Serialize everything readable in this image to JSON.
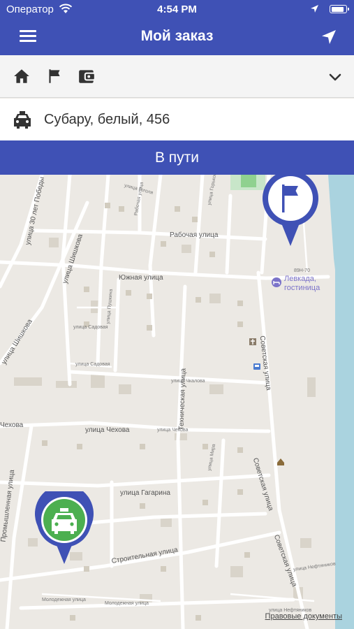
{
  "status_bar": {
    "carrier": "Оператор",
    "time": "4:54 PM",
    "battery_percent": 86
  },
  "header": {
    "title": "Мой заказ",
    "menu_icon": "hamburger-menu-icon",
    "action_icon": "navigation-arrow-icon"
  },
  "toolbar": {
    "icons": [
      "home-icon",
      "flag-icon",
      "wallet-icon"
    ],
    "expand_icon": "chevron-down-icon"
  },
  "car": {
    "icon": "taxi-car-icon",
    "description": "Субару, белый, 456"
  },
  "order_status": "В пути",
  "map": {
    "streets": {
      "s1": "улица 30 лет Победы",
      "s2": "улица Шишкова",
      "s3": "улица Шишкова",
      "s4": "Рабочая улица",
      "s5": "Южная улица",
      "s6": "Советская улица",
      "s7": "Техническая улица",
      "s8": "Чехова",
      "s9": "улица Чехова",
      "s10": "Советская улица",
      "s11": "улица Гагарина",
      "s12": "Промышленная улица",
      "s13": "Строительная улица",
      "s14": "Советская улица",
      "s15": "Молодежная улица"
    },
    "small_labels": {
      "a": "улица Гоголя",
      "b": "улица Горького",
      "c": "улица Пушкина",
      "d": "Рабочая улица",
      "e": "улица Садовая",
      "f": "улица Садовая",
      "g": "улица Чкалова",
      "h": "улица Чехова",
      "i": "улица Мира",
      "j": "улица Нефтяников",
      "k": "улица Нефтяников",
      "l": "Молодежная улица",
      "m": "89Н-70"
    },
    "poi_hotel": {
      "line1": "Левкада,",
      "line2": "гостиница"
    },
    "destination_marker_icon": "flag-icon",
    "taxi_marker_icon": "taxi-car-icon",
    "destination_color": "#3f51b5",
    "taxi_color": "#4caf50"
  },
  "legal_link": "Правовые документы",
  "colors": {
    "primary": "#3f51b5",
    "map_bg": "#ece9e4",
    "road": "#ffffff"
  }
}
